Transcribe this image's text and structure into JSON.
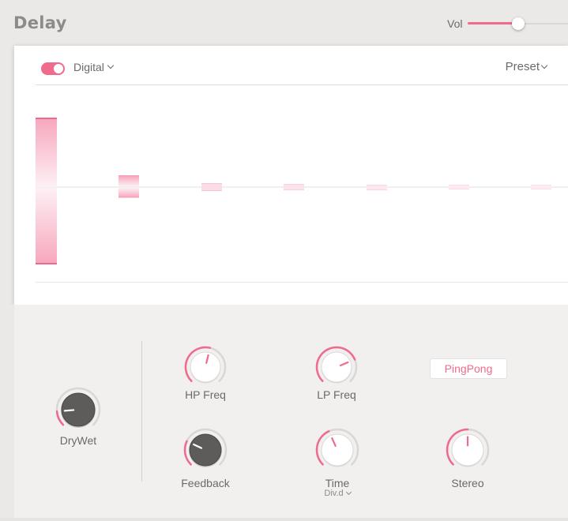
{
  "header": {
    "title": "Delay",
    "vol_label": "Vol",
    "vol_value": 0.5
  },
  "panel": {
    "enabled": true,
    "mode_label": "Digital",
    "preset_label": "Preset"
  },
  "controls": {
    "drywet": {
      "label": "DryWet",
      "value": 0.15,
      "style": "dark"
    },
    "hp_freq": {
      "label": "HP Freq",
      "value": 0.55,
      "style": "light"
    },
    "lp_freq": {
      "label": "LP Freq",
      "value": 0.75,
      "style": "light"
    },
    "feedback": {
      "label": "Feedback",
      "value": 0.26,
      "style": "dark"
    },
    "time": {
      "label": "Time",
      "sublabel": "Div.d",
      "value": 0.41,
      "style": "light"
    },
    "stereo": {
      "label": "Stereo",
      "value": 0.5,
      "style": "light"
    },
    "pingpong_label": "PingPong"
  },
  "colors": {
    "accent": "#f06a8d",
    "knob_dark": "#5e5c5a",
    "knob_light": "#ffffff"
  }
}
